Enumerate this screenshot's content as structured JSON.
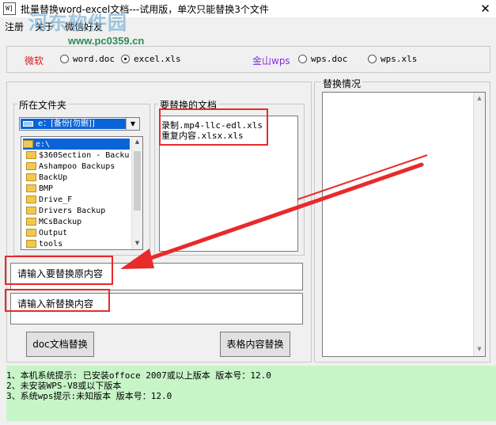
{
  "window": {
    "title": "批量替换word-excel文档---试用版，单次只能替换3个文件",
    "icon_text": "W]"
  },
  "watermark": {
    "logo": "河东软件园",
    "url": "www.pc0359.cn"
  },
  "menu": {
    "items": [
      "注册",
      "关于",
      "微信好友"
    ]
  },
  "options": {
    "microsoft_label": "微软",
    "wps_label": "金山wps",
    "radios": [
      {
        "label": "word.doc",
        "checked": false
      },
      {
        "label": "excel.xls",
        "checked": true
      },
      {
        "label": "wps.doc",
        "checked": false
      },
      {
        "label": "wps.xls",
        "checked": false
      }
    ]
  },
  "folder_panel": {
    "label": "所在文件夹",
    "drive": "e：[备份[勿删]]",
    "root": "e:\\",
    "folders": [
      "$360Section - Backu",
      "Ashampoo Backups",
      "BackUp",
      "BMP",
      "Drive_F",
      "Drivers Backup",
      "MCsBackup",
      "Output",
      "tools"
    ]
  },
  "target_panel": {
    "label": "要替换的文档",
    "files": [
      "录制.mp4-llc-edl.xls",
      "重复内容.xlsx.xls"
    ]
  },
  "inputs": {
    "original_placeholder": "请输入要替换原内容",
    "new_placeholder": "请输入新替换内容"
  },
  "buttons": {
    "doc_replace": "doc文档替换",
    "table_replace": "表格内容替换"
  },
  "result_panel": {
    "label": "替换情况"
  },
  "status": {
    "lines": [
      "1、本机系统提示: 已安装offoce 2007或以上版本 版本号：12.0",
      "2、未安装WPS-V8或以下版本",
      "3、系统wps提示:未知版本 版本号：12.0"
    ]
  },
  "colors": {
    "highlight_red": "#e82a2a",
    "status_bg": "#c8f5c8",
    "brand_red": "#d02020",
    "brand_purple": "#8a2be2",
    "selection_blue": "#0a64d8"
  }
}
